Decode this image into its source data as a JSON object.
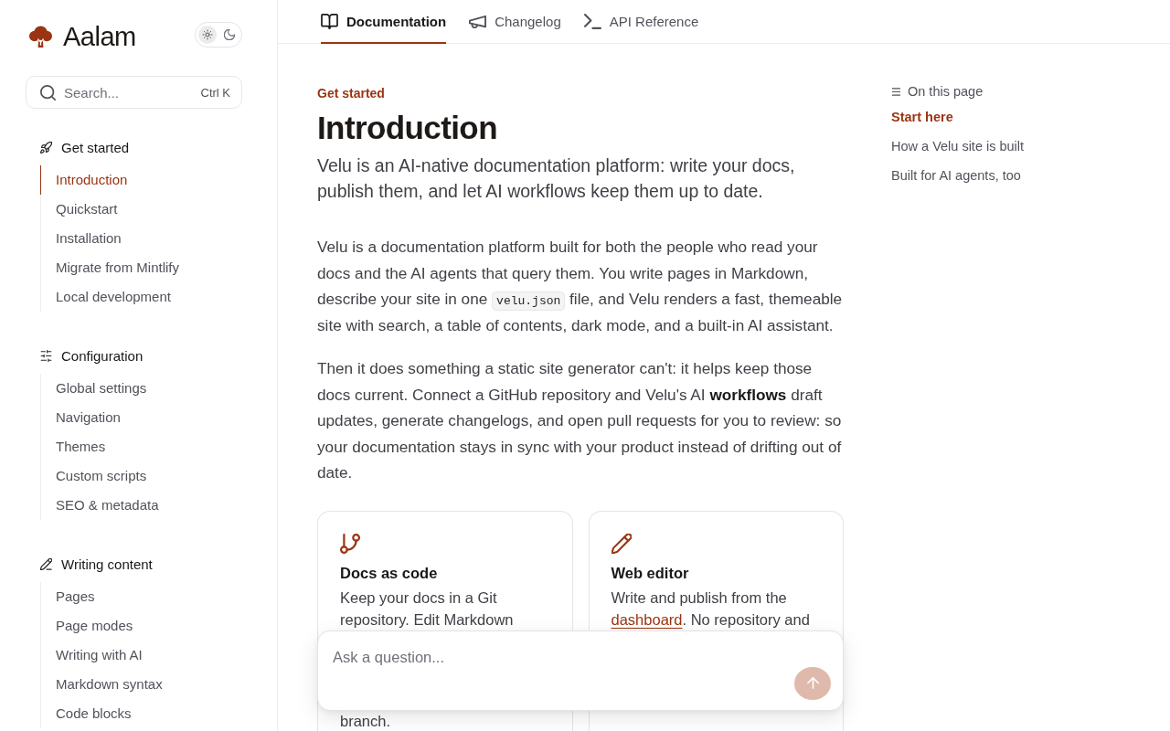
{
  "sidebar": {
    "logo": {
      "text": "Aalam"
    },
    "theme_toggle": [
      {
        "selected": true
      },
      {
        "selected": false
      }
    ],
    "search": {
      "placeholder": "Search...",
      "shortcut": "Ctrl K"
    },
    "sections": [
      {
        "title": "Get started",
        "items": [
          {
            "label": "Introduction",
            "selected": true
          },
          {
            "label": "Quickstart",
            "selected": false
          },
          {
            "label": "Installation",
            "selected": false
          },
          {
            "label": "Migrate from Mintlify",
            "selected": false
          },
          {
            "label": "Local development",
            "selected": false
          }
        ]
      },
      {
        "title": "Configuration",
        "items": [
          {
            "label": "Global settings",
            "selected": false
          },
          {
            "label": "Navigation",
            "selected": false
          },
          {
            "label": "Themes",
            "selected": false
          },
          {
            "label": "Custom scripts",
            "selected": false
          },
          {
            "label": "SEO & metadata",
            "selected": false
          }
        ]
      },
      {
        "title": "Writing content",
        "items": [
          {
            "label": "Pages",
            "selected": false
          },
          {
            "label": "Page modes",
            "selected": false
          },
          {
            "label": "Writing with AI",
            "selected": false
          },
          {
            "label": "Markdown syntax",
            "selected": false
          },
          {
            "label": "Code blocks",
            "selected": false
          }
        ]
      }
    ]
  },
  "top_nav": {
    "tabs": [
      {
        "label": "Documentation",
        "selected": true
      },
      {
        "label": "Changelog",
        "selected": false
      },
      {
        "label": "API Reference",
        "selected": false
      }
    ]
  },
  "article": {
    "eyebrow": "Get started",
    "title": "Introduction",
    "lead": "Velu is an AI-native documentation platform: write your docs, publish them, and let AI workflows keep them up to date.",
    "paragraphs": [
      [
        {
          "kind": "text",
          "text": "Velu is a documentation platform built for both the people who read your docs and the AI agents that query them. You write pages in Markdown, describe your site in one "
        },
        {
          "kind": "code",
          "text": "velu.json"
        },
        {
          "kind": "text",
          "text": " file, and Velu renders a fast, themeable site with search, a table of contents, dark mode, and a built-in AI assistant."
        }
      ],
      [
        {
          "kind": "text",
          "text": "Then it does something a static site generator can't: it helps keep those docs current. Connect a GitHub repository and Velu's AI **workflows** draft updates, generate changelogs, and open pull requests for you to review: so your documentation stays in sync with your product instead of drifting out of date."
        }
      ]
    ],
    "cards": [
      {
        "title": "Docs as code",
        "body": [
          {
            "kind": "text",
            "text": "Keep your docs in a Git repository. Edit Markdown"
          }
        ],
        "tail": "branch."
      },
      {
        "title": "Web editor",
        "body": [
          {
            "kind": "text",
            "text": "Write and publish from the "
          },
          {
            "kind": "link",
            "text": "dashboard"
          },
          {
            "kind": "text",
            "text": ". No repository and"
          }
        ]
      }
    ]
  },
  "ask_box": {
    "placeholder": "Ask a question...",
    "send_disabled": true
  },
  "toc": {
    "title": "On this page",
    "items": [
      {
        "label": "Start here",
        "selected": true
      },
      {
        "label": "How a Velu site is built",
        "selected": false
      },
      {
        "label": "Built for AI agents, too",
        "selected": false
      }
    ]
  }
}
